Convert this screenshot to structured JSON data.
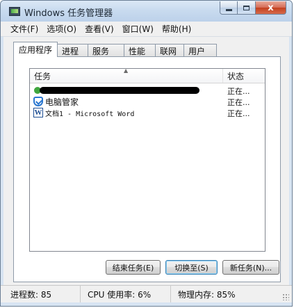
{
  "window": {
    "title": "Windows 任务管理器",
    "controls": {
      "minimize": "minimize",
      "maximize": "maximize",
      "close": "x"
    }
  },
  "menu": [
    "文件(F)",
    "选项(O)",
    "查看(V)",
    "窗口(W)",
    "帮助(H)"
  ],
  "tabs": [
    "应用程序",
    "进程",
    "服务",
    "性能",
    "联网",
    "用户"
  ],
  "active_tab": "应用程序",
  "list": {
    "columns": {
      "task": "任务",
      "status": "状态"
    },
    "sort_indicator": "▲",
    "rows": [
      {
        "name": "",
        "status": "正在...",
        "icon": "green-app-icon"
      },
      {
        "name": "电脑管家",
        "status": "正在...",
        "icon": "shield-icon"
      },
      {
        "name": "文档1 - Microsoft Word",
        "status": "正在...",
        "icon": "word-icon"
      }
    ]
  },
  "buttons": {
    "end_task": "结束任务(E)",
    "switch_to": "切换至(S)",
    "new_task": "新任务(N)..."
  },
  "status_bar": {
    "processes": "进程数: 85",
    "cpu": "CPU 使用率: 6%",
    "memory": "物理内存: 85%"
  },
  "colors": {
    "titlebar": "#c9dbef",
    "close_button": "#c2401f",
    "selection_border": "#3c7fb1"
  }
}
